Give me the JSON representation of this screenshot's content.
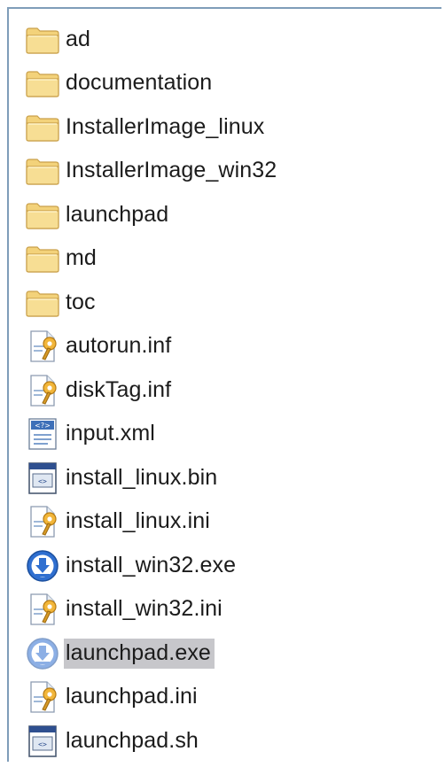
{
  "files": [
    {
      "name": "ad",
      "icon": "folder-icon"
    },
    {
      "name": "documentation",
      "icon": "folder-icon"
    },
    {
      "name": "InstallerImage_linux",
      "icon": "folder-icon"
    },
    {
      "name": "InstallerImage_win32",
      "icon": "folder-icon"
    },
    {
      "name": "launchpad",
      "icon": "folder-icon"
    },
    {
      "name": "md",
      "icon": "folder-icon"
    },
    {
      "name": "toc",
      "icon": "folder-icon"
    },
    {
      "name": "autorun.inf",
      "icon": "settings-file-icon"
    },
    {
      "name": "diskTag.inf",
      "icon": "settings-file-icon"
    },
    {
      "name": "input.xml",
      "icon": "xml-file-icon"
    },
    {
      "name": "install_linux.bin",
      "icon": "binary-file-icon"
    },
    {
      "name": "install_linux.ini",
      "icon": "settings-file-icon"
    },
    {
      "name": "install_win32.exe",
      "icon": "installer-exe-icon"
    },
    {
      "name": "install_win32.ini",
      "icon": "settings-file-icon"
    },
    {
      "name": "launchpad.exe",
      "icon": "installer-exe-icon",
      "selected": true
    },
    {
      "name": "launchpad.ini",
      "icon": "settings-file-icon"
    },
    {
      "name": "launchpad.sh",
      "icon": "binary-file-icon"
    }
  ],
  "colors": {
    "folder": "#f3d27a",
    "selection": "#c7c7cb",
    "border": "#7f9db9"
  }
}
